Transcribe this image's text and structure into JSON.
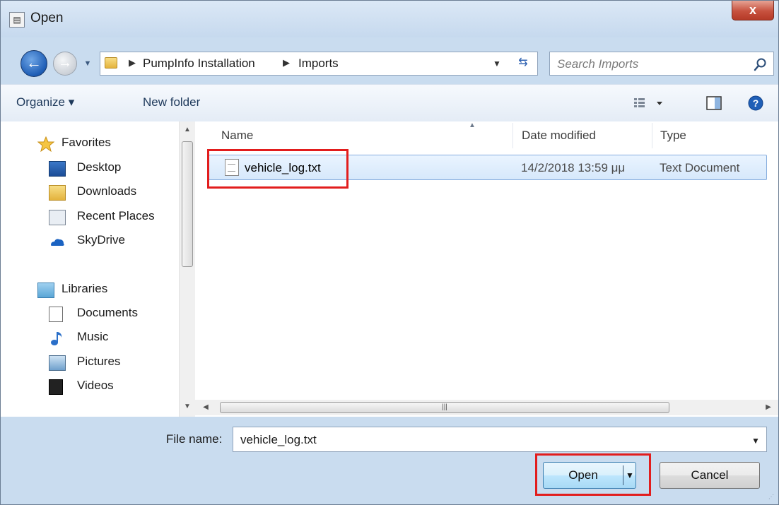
{
  "window": {
    "title": "Open",
    "close_glyph": "x"
  },
  "navigation": {
    "breadcrumbs": [
      "PumpInfo Installation",
      "Imports"
    ]
  },
  "search": {
    "placeholder": "Search Imports"
  },
  "toolbar": {
    "organize_label": "Organize ▾",
    "new_folder_label": "New folder"
  },
  "sidebar": {
    "favorites_label": "Favorites",
    "favorites": [
      {
        "label": "Desktop",
        "icon": "desktop-icon"
      },
      {
        "label": "Downloads",
        "icon": "downloads-icon"
      },
      {
        "label": "Recent Places",
        "icon": "recent-places-icon"
      },
      {
        "label": "SkyDrive",
        "icon": "skydrive-icon"
      }
    ],
    "libraries_label": "Libraries",
    "libraries": [
      {
        "label": "Documents",
        "icon": "documents-icon"
      },
      {
        "label": "Music",
        "icon": "music-icon"
      },
      {
        "label": "Pictures",
        "icon": "pictures-icon"
      },
      {
        "label": "Videos",
        "icon": "videos-icon"
      }
    ]
  },
  "file_list": {
    "columns": [
      "Name",
      "Date modified",
      "Type"
    ],
    "rows": [
      {
        "name": "vehicle_log.txt",
        "date_modified": "14/2/2018 13:59 μμ",
        "type": "Text Document",
        "selected": true
      }
    ]
  },
  "bottom": {
    "file_name_label": "File name:",
    "file_name_value": "vehicle_log.txt",
    "open_label": "Open",
    "cancel_label": "Cancel"
  },
  "colors": {
    "highlight": "#e21d1d",
    "selection": "#d6e8fb",
    "frame": "#c9dcef"
  }
}
